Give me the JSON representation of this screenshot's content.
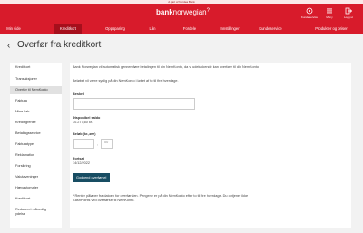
{
  "topbar": {
    "text": "A part of Nordea Bank"
  },
  "header": {
    "brand_bold": "bank",
    "brand_rest": "norwegian",
    "icons": [
      {
        "label": "Kundeservice",
        "icon": "support-icon"
      },
      {
        "label": "Meny",
        "icon": "menu-icon"
      },
      {
        "label": "Logg ut",
        "icon": "logout-icon"
      }
    ]
  },
  "nav": [
    {
      "label": "Min side"
    },
    {
      "label": "Kreditkort"
    },
    {
      "label": "Oppsparing"
    },
    {
      "label": "Lån"
    },
    {
      "label": "Fordele"
    },
    {
      "label": "Innstillinger"
    },
    {
      "label": "Kundeservice"
    },
    {
      "label": "Produkter og priser"
    }
  ],
  "page": {
    "title": "Overfør fra kreditkort"
  },
  "sidebar": [
    {
      "label": "Kreditkort"
    },
    {
      "label": "Transaksjoner"
    },
    {
      "label": "Overfør til NemKonto"
    },
    {
      "label": "Faktura"
    },
    {
      "label": "Mine kab"
    },
    {
      "label": "Kredittgrense"
    },
    {
      "label": "Betalingsservice"
    },
    {
      "label": "Fakturatype"
    },
    {
      "label": "Reklamation"
    },
    {
      "label": "Forsikring"
    },
    {
      "label": "Valutaveninger"
    },
    {
      "label": "Hævautomater"
    },
    {
      "label": "Kreditkort"
    },
    {
      "label": "Reduceret månedlig ydelse"
    }
  ],
  "main": {
    "intro_1": "Bank Norwegian vil automatisk gennemføre betalingen til din NemKonto, da vi udelukkende kan overføre til din NemKonto",
    "intro_2": "Beløbet vil være synlig på din NemKonto i løbet af to til fire hverdage.",
    "konto_label": "Beskrd",
    "available_label": "Disponibel saldo",
    "available_value": "30.277,60 kr.",
    "amount_label": "Beløb (kr.,øre)",
    "amount_value": "",
    "ore_placeholder": "00",
    "date_label": "Fortsat",
    "date_value": "14/12/2022",
    "button_label": "Godkend overførsel",
    "footnote": "* Renter påløber fra datoen for overførslen. Pengene er på din NemKonto efter to til fire hverdage. Du optjener ikke CashPoints ved overførsel til NemKonto."
  }
}
